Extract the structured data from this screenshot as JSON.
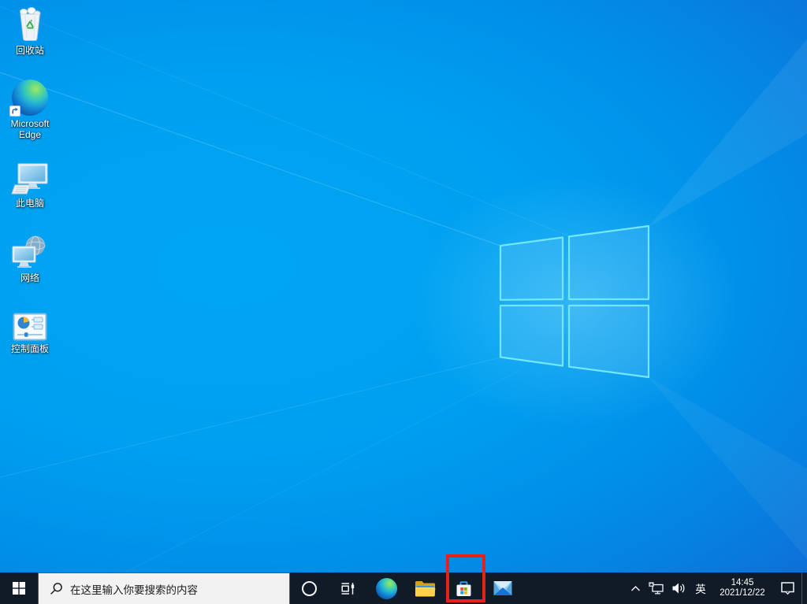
{
  "wallpaper": {
    "style": "windows10-light-logo",
    "base_color": "#009ff0",
    "corner_color": "#1b50c2",
    "logo_edge_color": "#74e7ff"
  },
  "desktop": {
    "icons": [
      {
        "id": "recycle-bin",
        "label": "回收站"
      },
      {
        "id": "microsoft-edge",
        "label": "Microsoft Edge"
      },
      {
        "id": "this-pc",
        "label": "此电脑"
      },
      {
        "id": "network",
        "label": "网络"
      },
      {
        "id": "control-panel",
        "label": "控制面板"
      }
    ]
  },
  "taskbar": {
    "background_color": "#111a27",
    "start": {
      "icon": "windows-logo"
    },
    "search": {
      "placeholder": "在这里输入你要搜索的内容",
      "icon": "search-icon"
    },
    "apps": [
      {
        "name": "cortana",
        "icon": "circle-outline"
      },
      {
        "name": "task-view",
        "icon": "task-view-icon"
      },
      {
        "name": "microsoft-edge",
        "icon": "edge-swirl"
      },
      {
        "name": "file-explorer",
        "icon": "yellow-folder"
      },
      {
        "name": "microsoft-store",
        "icon": "store-bag"
      },
      {
        "name": "mail",
        "icon": "envelope"
      }
    ],
    "tray": {
      "hidden_icons": {
        "icon": "chevron-up"
      },
      "network": {
        "icon": "ethernet-monitor"
      },
      "volume": {
        "icon": "speaker"
      },
      "ime_label": "英",
      "time": "14:45",
      "date": "2021/12/22",
      "action_center": {
        "icon": "notification-bubble"
      }
    },
    "store_colors": {
      "red": "#f25022",
      "green": "#7fba00",
      "blue": "#00a4ef",
      "yellow": "#ffb900"
    }
  },
  "annotation": {
    "shape": "rectangle",
    "color": "#e62117",
    "highlights": "microsoft-store-taskbar-icon"
  }
}
